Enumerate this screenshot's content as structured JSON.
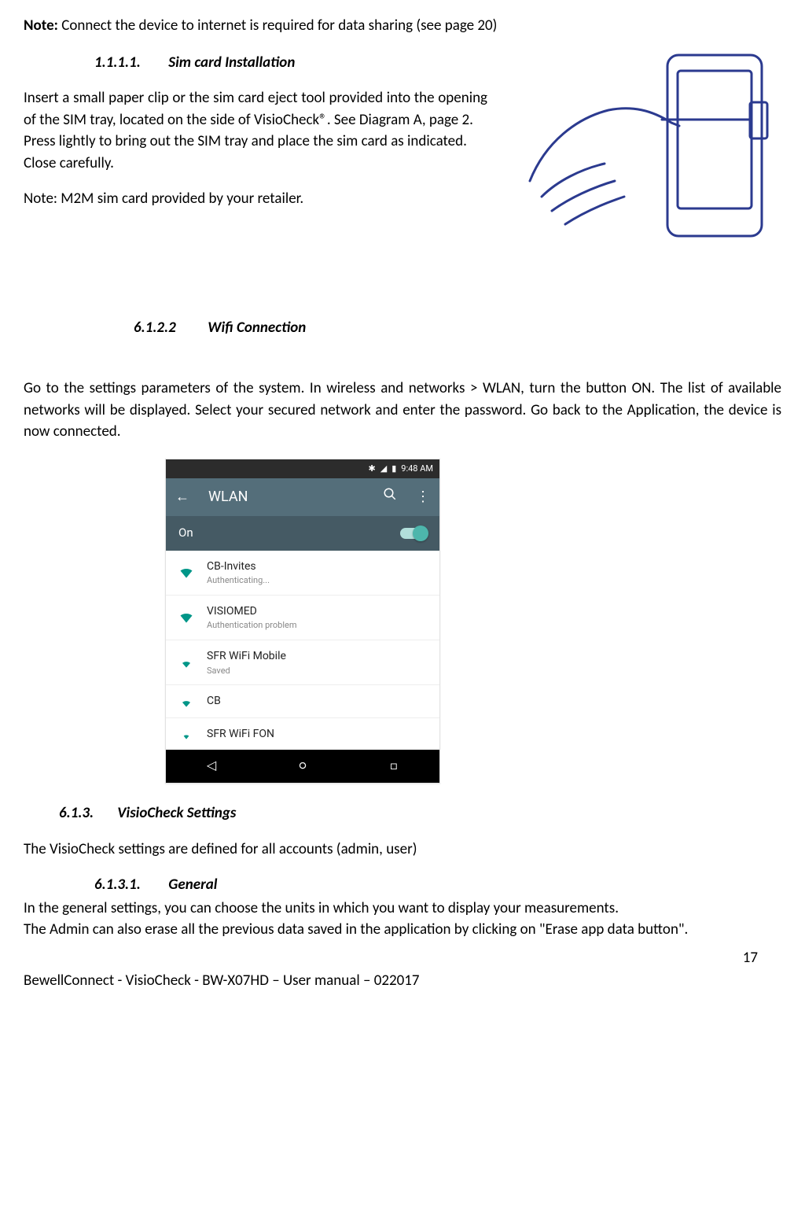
{
  "note": {
    "label": "Note:",
    "text": " Connect the device to internet is required for data sharing (see page 20)"
  },
  "s1": {
    "num": "1.1.1.1.",
    "title": "Sim card Installation",
    "p1": "Insert a small paper clip or the sim card eject tool provided into the opening of the SIM tray, located on the side of VisioCheck®. See Diagram A, page 2.",
    "p2": "Press lightly to bring out the SIM tray and place the sim card as indicated.",
    "p3": "Close carefully.",
    "p4": "Note: M2M sim card provided by your retailer."
  },
  "s2": {
    "num": "6.1.2.2",
    "title": "Wifi Connection",
    "p1": "Go to the settings parameters of the system. In wireless and networks > WLAN, turn the button ON. The list of available networks will be displayed. Select your secured network and enter the password. Go back to the Application, the device is now connected."
  },
  "wlan": {
    "status_time": "9:48 AM",
    "back": "←",
    "title": "WLAN",
    "search_icon": "search",
    "more_icon": "⋮",
    "toggle_label": "On",
    "networks": [
      {
        "ssid": "CB-Invites",
        "sub": "Authenticating..."
      },
      {
        "ssid": "VISIOMED",
        "sub": "Authentication problem"
      },
      {
        "ssid": "SFR WiFi Mobile",
        "sub": "Saved"
      },
      {
        "ssid": "CB",
        "sub": ""
      },
      {
        "ssid": "SFR WiFi FON",
        "sub": ""
      }
    ]
  },
  "s3": {
    "num": "6.1.3.",
    "title": "VisioCheck Settings",
    "p1": "The VisioCheck settings are defined for all accounts (admin, user)"
  },
  "s4": {
    "num": "6.1.3.1.",
    "title": "General",
    "p1": "In the general settings, you can choose the units in which you want to display your measurements.",
    "p2": "The Admin can also erase all the previous data saved in the application by clicking on \"Erase app data button\"."
  },
  "page_number": "17",
  "footer": "BewellConnect - VisioCheck - BW-X07HD – User manual – 022017"
}
